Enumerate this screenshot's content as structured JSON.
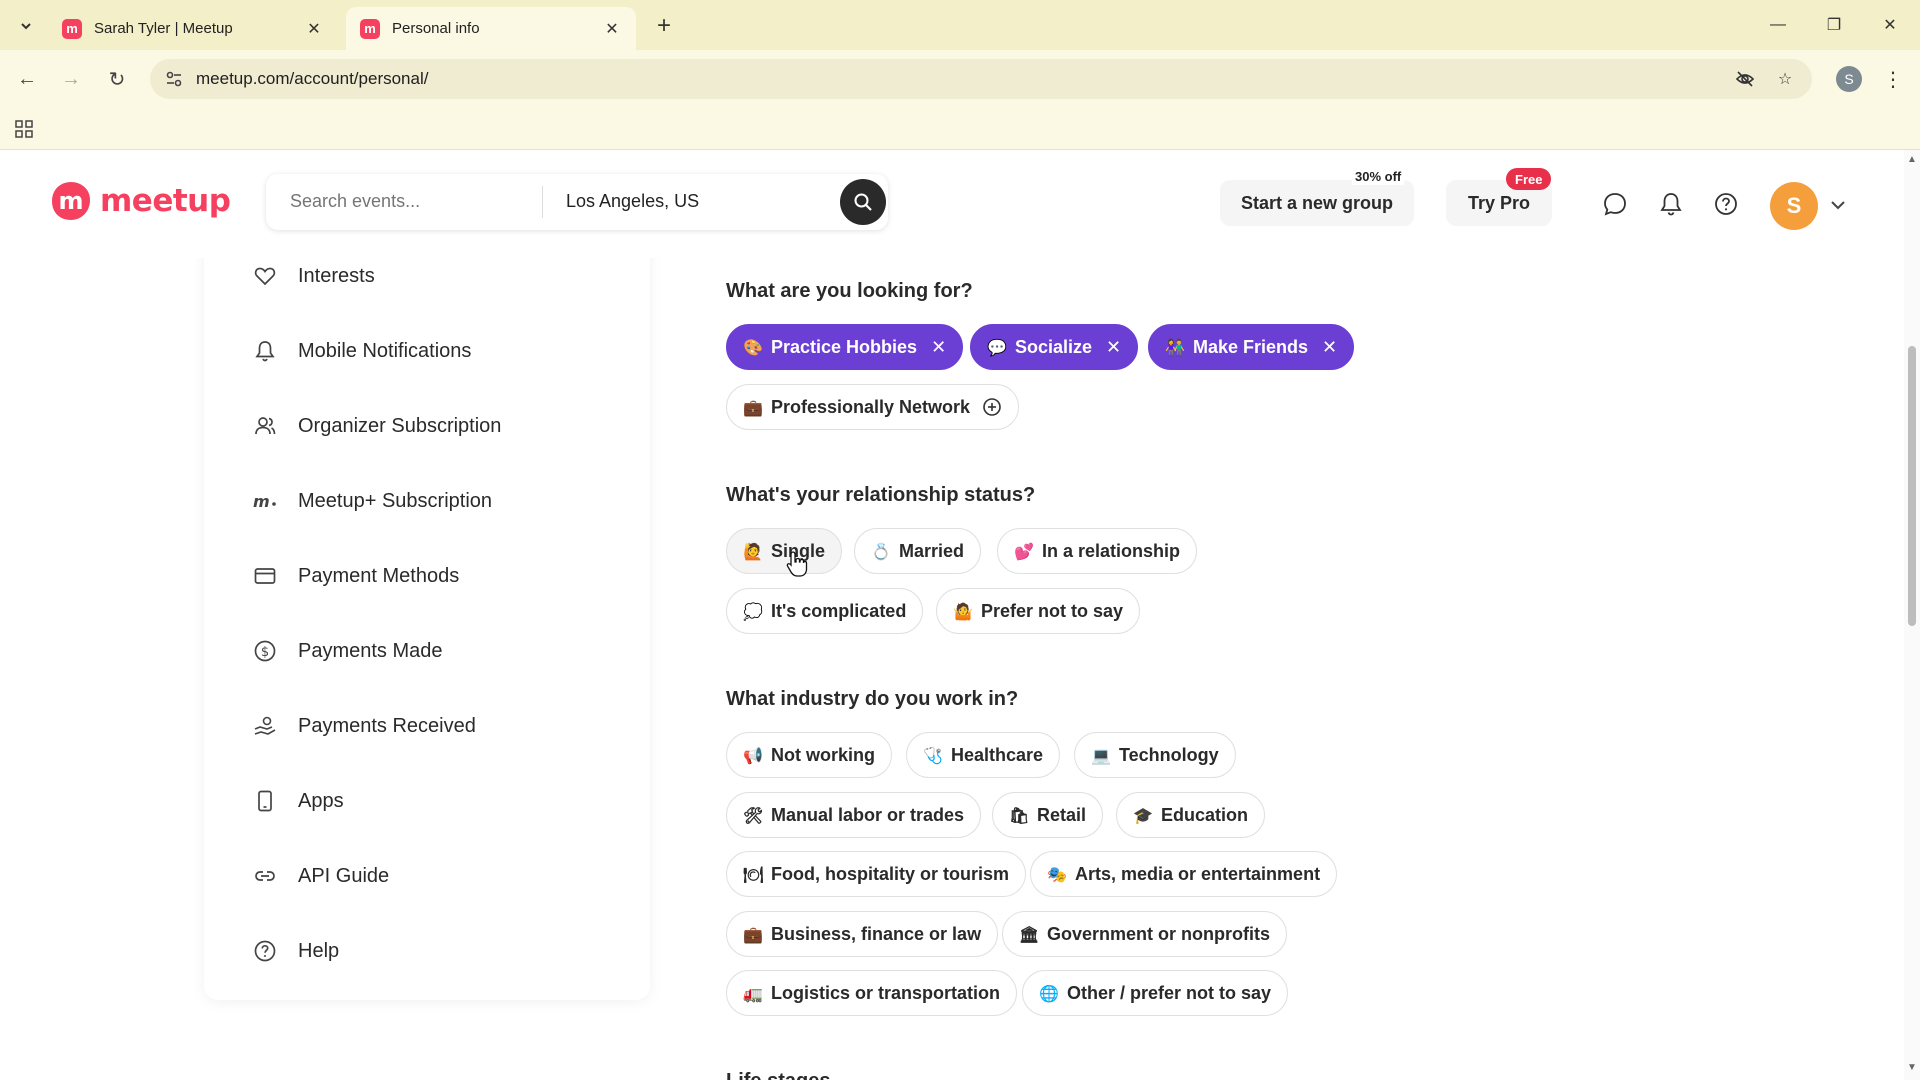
{
  "browser": {
    "tabs": [
      {
        "title": "Sarah Tyler | Meetup",
        "active": false
      },
      {
        "title": "Personal info",
        "active": true
      }
    ],
    "url": "meetup.com/account/personal/",
    "profile_initial": "S"
  },
  "header": {
    "logo_text": "meetup",
    "search_placeholder": "Search events...",
    "location": "Los Angeles, US",
    "start_group_label": "Start a new group",
    "start_group_badge": "30% off",
    "try_pro_label": "Try Pro",
    "try_pro_badge": "Free",
    "avatar_initial": "S"
  },
  "sidebar": {
    "items": [
      {
        "label": "Interests",
        "icon": "heart-icon"
      },
      {
        "label": "Mobile Notifications",
        "icon": "bell-icon"
      },
      {
        "label": "Organizer Subscription",
        "icon": "users-icon"
      },
      {
        "label": "Meetup+ Subscription",
        "icon": "meetup-plus-icon"
      },
      {
        "label": "Payment Methods",
        "icon": "credit-card-icon"
      },
      {
        "label": "Payments Made",
        "icon": "dollar-circle-icon"
      },
      {
        "label": "Payments Received",
        "icon": "hand-coin-icon"
      },
      {
        "label": "Apps",
        "icon": "phone-icon"
      },
      {
        "label": "API Guide",
        "icon": "link-icon"
      },
      {
        "label": "Help",
        "icon": "help-circle-icon"
      }
    ]
  },
  "looking_for": {
    "title": "What are you looking for?",
    "options": [
      {
        "label": "Practice Hobbies",
        "emoji": "🎨",
        "selected": true
      },
      {
        "label": "Socialize",
        "emoji": "💬",
        "selected": true
      },
      {
        "label": "Make Friends",
        "emoji": "👫",
        "selected": true
      },
      {
        "label": "Professionally Network",
        "emoji": "💼",
        "selected": false
      }
    ]
  },
  "relationship": {
    "title": "What's your relationship status?",
    "options": [
      {
        "label": "Single",
        "emoji": "🙋"
      },
      {
        "label": "Married",
        "emoji": "💍"
      },
      {
        "label": "In a relationship",
        "emoji": "💕"
      },
      {
        "label": "It's complicated",
        "emoji": "💭"
      },
      {
        "label": "Prefer not to say",
        "emoji": "🤷"
      }
    ]
  },
  "industry": {
    "title": "What industry do you work in?",
    "options": [
      {
        "label": "Not working",
        "emoji": "📢"
      },
      {
        "label": "Healthcare",
        "emoji": "🩺"
      },
      {
        "label": "Technology",
        "emoji": "💻"
      },
      {
        "label": "Manual labor or trades",
        "emoji": "🛠"
      },
      {
        "label": "Retail",
        "emoji": "🛍"
      },
      {
        "label": "Education",
        "emoji": "🎓"
      },
      {
        "label": "Food, hospitality or tourism",
        "emoji": "🍽"
      },
      {
        "label": "Arts, media or entertainment",
        "emoji": "🎭"
      },
      {
        "label": "Business, finance or law",
        "emoji": "💼"
      },
      {
        "label": "Government or nonprofits",
        "emoji": "🏛"
      },
      {
        "label": "Logistics or transportation",
        "emoji": "🚛"
      },
      {
        "label": "Other / prefer not to say",
        "emoji": "🌐"
      }
    ]
  },
  "next_section_title": "Life stages",
  "colors": {
    "brand": "#f64060",
    "selected_chip": "#6b3fd4",
    "browser_frame": "#f3efc8"
  }
}
